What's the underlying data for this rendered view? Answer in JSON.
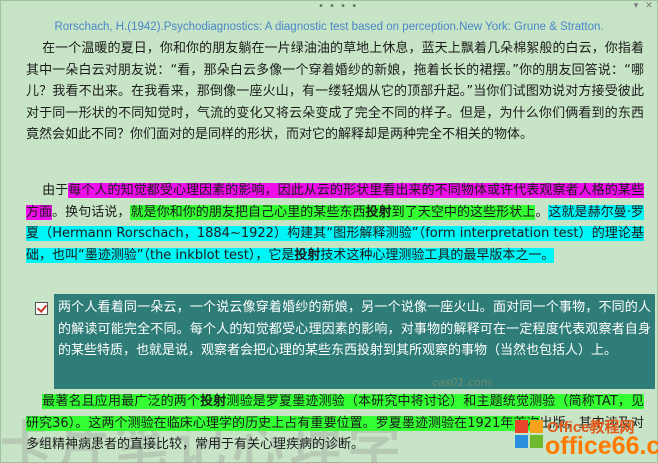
{
  "citation": "Rorschach, H.(1942).Psychodiagnostics: A diagnostic test based on perception.New York: Grune & Stratton.",
  "para1": "在一个温暖的夏日，你和你的朋友躺在一片绿油油的草地上休息，蓝天上飘着几朵棉絮般的白云，你指着其中一朵白云对朋友说：“看，那朵白云多像一个穿着婚纱的新娘，拖着长长的裙摆。”你的朋友回答说：“哪儿？我看不出来。在我看来，那倒像一座火山，有一缕轻烟从它的顶部升起。”当你们试图劝说对方接受彼此对于同一形状的不同知觉时，气流的变化又将云朵变成了完全不同的样子。但是，为什么你们俩看到的东西竟然会如此不同？你们面对的是同样的形状，而对它的解释却是两种完全不相关的物体。",
  "para2": {
    "lead": "由于",
    "magenta": "每个人的知觉都受心理因素的影响，因此从云的形状里看出来的不同物体或许代表观察者人格的某些方面",
    "after_magenta": "。换句话说，",
    "green_a": "就是你和你的朋友把自己心里的某些东西",
    "green_bold": "投射",
    "green_b": "到了天空中的这些形状上",
    "after_green": "。",
    "cyan_a": "这就是赫尔曼·罗夏（Hermann Rorschach，1884~1922）构建其“图形解释测验”（form interpretation test）的理论基础，也叫“墨迹测验”（the inkblot test），它是",
    "cyan_bold": "投射",
    "cyan_b": "技术这种心理测验工具的最早版本之一。"
  },
  "note": "两个人看着同一朵云，一个说云像穿着婚纱的新娘，另一个说像一座火山。面对同一个事物，不同的人的解读可能完全不同。每个人的知觉都受心理因素的影响，对事物的解释可在一定程度代表观察者自身的某些特质，也就是说，观察者会把心理的某些东西投射到其所观察的事物（当然也包括人）上。",
  "para4": {
    "green_a": "最著名且应用最广泛的两个",
    "green_bold": "投射",
    "green_b": "测验是罗夏墨迹测验（本研究中将讨论）和主题统觉测验（简称TAT，见研究36）。这两个测验在临床心理学的历史上占有重要位置。罗夏墨迹测验在1921年首次",
    "rest": "出版，其中涉及对多组精神病患者的直接比较，常用于有关心理疾病的诊断。"
  },
  "watermark_url": "cas01.com",
  "logo": {
    "top_text": "Office教程网",
    "bottom_text": "office66.cn"
  }
}
